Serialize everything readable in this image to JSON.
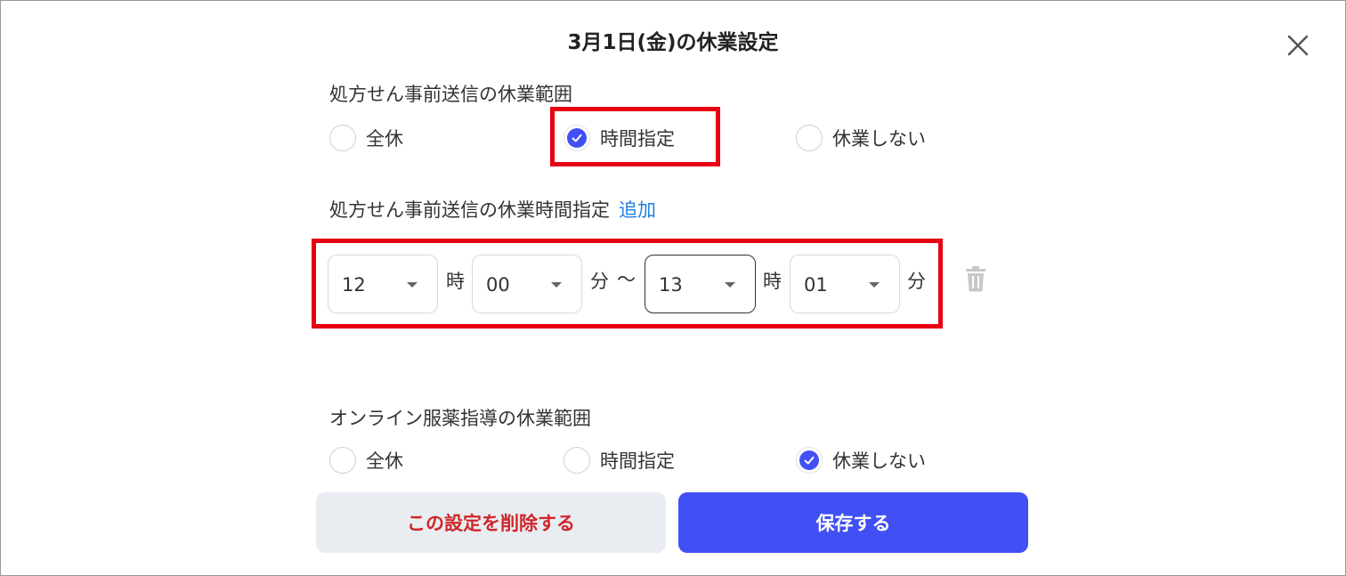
{
  "dialog": {
    "title": "3月1日(金)の休業設定"
  },
  "prescription": {
    "range_label": "処方せん事前送信の休業範囲",
    "options": [
      {
        "label": "全休",
        "selected": false
      },
      {
        "label": "時間指定",
        "selected": true
      },
      {
        "label": "休業しない",
        "selected": false
      }
    ],
    "time_label": "処方せん事前送信の休業時間指定",
    "add_link": "追加",
    "time_range": {
      "start_hour": "12",
      "start_minute": "00",
      "end_hour": "13",
      "end_minute": "01",
      "hour_unit": "時",
      "minute_unit": "分",
      "separator": "〜"
    }
  },
  "online": {
    "range_label": "オンライン服薬指導の休業範囲",
    "options": [
      {
        "label": "全休",
        "selected": false
      },
      {
        "label": "時間指定",
        "selected": false
      },
      {
        "label": "休業しない",
        "selected": true
      }
    ]
  },
  "buttons": {
    "delete_label": "この設定を削除する",
    "save_label": "保存する"
  },
  "colors": {
    "accent": "#4150f5",
    "danger": "#d0262b",
    "highlight": "#e60012",
    "link": "#1f7fe0"
  },
  "icons": {
    "close": "close-icon",
    "check": "check-icon",
    "trash": "trash-icon",
    "dropdown": "caret-down-icon"
  }
}
